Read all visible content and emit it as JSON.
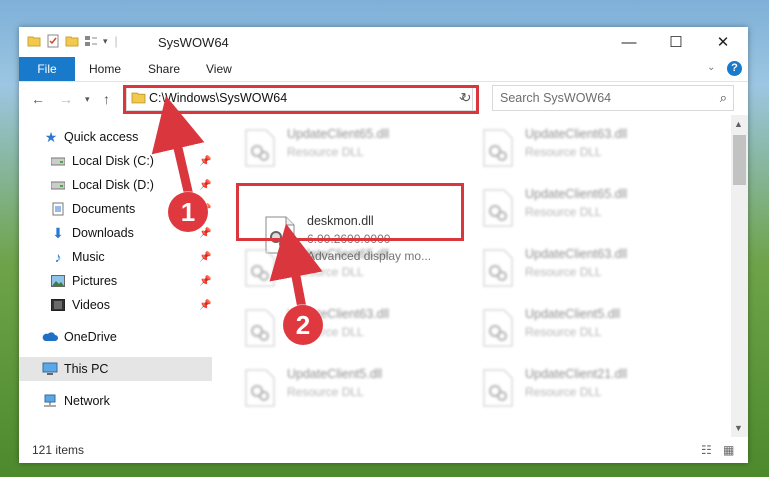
{
  "window": {
    "title": "SysWOW64",
    "controls": {
      "minimize": "—",
      "maximize": "☐",
      "close": "✕"
    }
  },
  "ribbon": {
    "file_tab": "File",
    "tabs": [
      "Home",
      "Share",
      "View"
    ],
    "help": "?"
  },
  "nav": {
    "address": "C:\\Windows\\SysWOW64",
    "search_placeholder": "Search SysWOW64"
  },
  "sidebar": {
    "items": [
      {
        "label": "Quick access",
        "icon": "star-icon",
        "pinned": false
      },
      {
        "label": "Local Disk (C:)",
        "icon": "drive-icon",
        "pinned": true
      },
      {
        "label": "Local Disk (D:)",
        "icon": "drive-icon",
        "pinned": true
      },
      {
        "label": "Documents",
        "icon": "documents-icon",
        "pinned": true
      },
      {
        "label": "Downloads",
        "icon": "downloads-icon",
        "pinned": true
      },
      {
        "label": "Music",
        "icon": "music-icon",
        "pinned": true
      },
      {
        "label": "Pictures",
        "icon": "pictures-icon",
        "pinned": true
      },
      {
        "label": "Videos",
        "icon": "videos-icon",
        "pinned": true
      },
      {
        "label": "OneDrive",
        "icon": "cloud-icon",
        "pinned": false
      },
      {
        "label": "This PC",
        "icon": "computer-icon",
        "pinned": false,
        "selected": true
      },
      {
        "label": "Network",
        "icon": "network-icon",
        "pinned": false
      }
    ]
  },
  "files": [
    {
      "name": "UpdateClient65.dll",
      "type": "Resource DLL",
      "blurred": true
    },
    {
      "name": "UpdateClient63.dll",
      "type": "Resource DLL",
      "blurred": true
    },
    {
      "name": "deskmon.dll",
      "version": "6.00.2600.0000",
      "description": "Advanced display mo...",
      "blurred": false
    },
    {
      "name": "UpdateClient65.dll",
      "type": "Resource DLL",
      "blurred": true
    },
    {
      "name": "UpdateClient65.dll",
      "type": "Resource DLL",
      "blurred": true
    },
    {
      "name": "UpdateClient63.dll",
      "type": "Resource DLL",
      "blurred": true
    },
    {
      "name": "UpdateClient63.dll",
      "type": "Resource DLL",
      "blurred": true
    },
    {
      "name": "UpdateClient5.dll",
      "type": "Resource DLL",
      "blurred": true
    },
    {
      "name": "UpdateClient5.dll",
      "type": "Resource DLL",
      "blurred": true
    },
    {
      "name": "UpdateClient21.dll",
      "type": "Resource DLL",
      "blurred": true
    }
  ],
  "status": {
    "item_count": "121 items"
  },
  "callouts": {
    "one": "1",
    "two": "2"
  },
  "colors": {
    "accent": "#1979ca",
    "highlight": "#d9363e"
  }
}
